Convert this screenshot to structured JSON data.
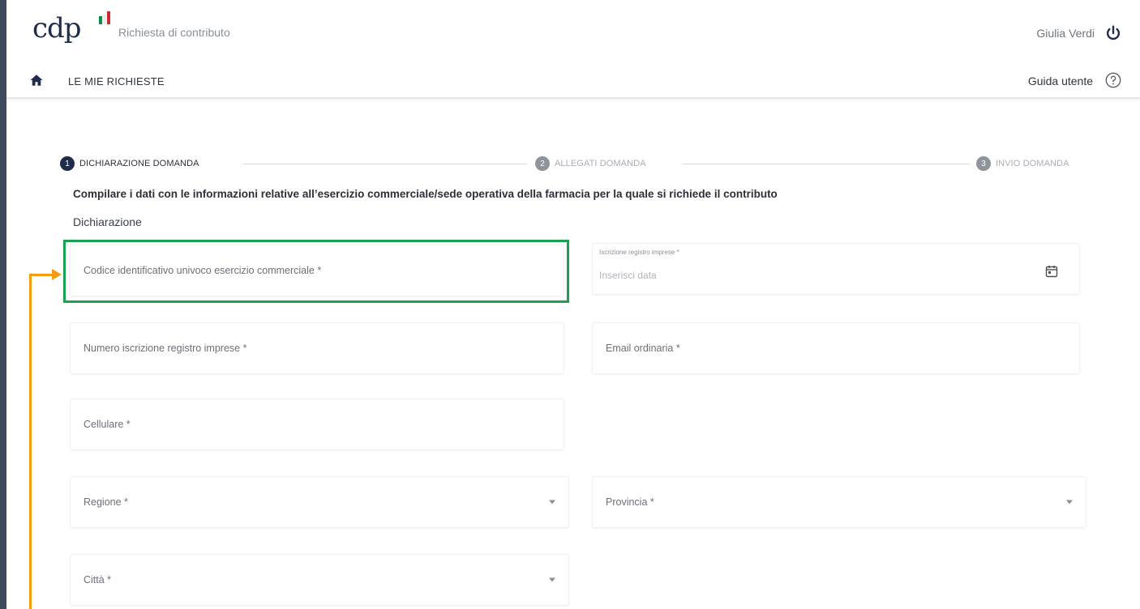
{
  "header": {
    "logo_text": "cdp",
    "app_title": "Richiesta di contributo",
    "user_name": "Giulia Verdi",
    "flag_colors": [
      "#009246",
      "#ffffff",
      "#ce2b37"
    ]
  },
  "nav": {
    "home_icon": "home-icon",
    "my_requests": "LE MIE RICHIESTE",
    "guide": "Guida utente"
  },
  "stepper": {
    "steps": [
      {
        "number": "1",
        "label": "DICHIARAZIONE DOMANDA",
        "active": true
      },
      {
        "number": "2",
        "label": "ALLEGATI DOMANDA",
        "active": false
      },
      {
        "number": "3",
        "label": "INVIO DOMANDA",
        "active": false
      }
    ]
  },
  "form": {
    "intro": "Compilare i dati con le informazioni relative all’esercizio commerciale/sede operativa della farmacia per la quale si richiede il contributo",
    "section_title": "Dichiarazione",
    "fields": {
      "codice": {
        "label": "Codice identificativo univoco esercizio commerciale *"
      },
      "iscrizione_data": {
        "label": "Iscrizione registro imprese *",
        "placeholder": "Inserisci data"
      },
      "numero_iscrizione": {
        "label": "Numero iscrizione registro imprese *"
      },
      "email": {
        "label": "Email ordinaria *"
      },
      "cellulare": {
        "label": "Cellulare *"
      },
      "regione": {
        "label": "Regione *"
      },
      "provincia": {
        "label": "Provincia *"
      },
      "citta": {
        "label": "Città *"
      }
    }
  },
  "annotation": {
    "highlight_color": "#1aa250",
    "arrow_color": "#f39c12"
  }
}
